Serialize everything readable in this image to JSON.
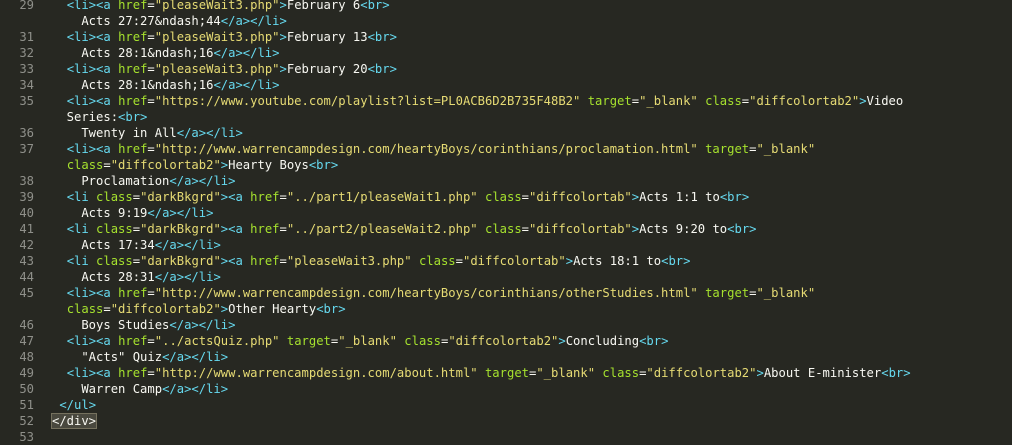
{
  "editor": {
    "colors": {
      "background": "#272822",
      "tag": "#66d9ef",
      "attribute": "#a6e22e",
      "string": "#e6db74",
      "text": "#f8f8f2",
      "gutter": "#8f908a",
      "highlight": "#49483e"
    },
    "lines": [
      {
        "num": "29",
        "tokens": [
          [
            "t",
            "  "
          ],
          [
            "g",
            "<li>"
          ],
          [
            "g",
            "<a "
          ],
          [
            "a",
            "href"
          ],
          [
            "t",
            "="
          ],
          [
            "s",
            "\"pleaseWait3.php\""
          ],
          [
            "g",
            ">"
          ],
          [
            "t",
            "February 6"
          ],
          [
            "g",
            "<br>"
          ]
        ]
      },
      {
        "num": "",
        "tokens": [
          [
            "t",
            "    Acts 27:27&ndash;44"
          ],
          [
            "g",
            "</a>"
          ],
          [
            "g",
            "</li>"
          ]
        ]
      },
      {
        "num": "31",
        "tokens": [
          [
            "t",
            "  "
          ],
          [
            "g",
            "<li>"
          ],
          [
            "g",
            "<a "
          ],
          [
            "a",
            "href"
          ],
          [
            "t",
            "="
          ],
          [
            "s",
            "\"pleaseWait3.php\""
          ],
          [
            "g",
            ">"
          ],
          [
            "t",
            "February 13"
          ],
          [
            "g",
            "<br>"
          ]
        ]
      },
      {
        "num": "32",
        "tokens": [
          [
            "t",
            "    Acts 28:1&ndash;16"
          ],
          [
            "g",
            "</a>"
          ],
          [
            "g",
            "</li>"
          ]
        ]
      },
      {
        "num": "33",
        "tokens": [
          [
            "t",
            "  "
          ],
          [
            "g",
            "<li>"
          ],
          [
            "g",
            "<a "
          ],
          [
            "a",
            "href"
          ],
          [
            "t",
            "="
          ],
          [
            "s",
            "\"pleaseWait3.php\""
          ],
          [
            "g",
            ">"
          ],
          [
            "t",
            "February 20"
          ],
          [
            "g",
            "<br>"
          ]
        ]
      },
      {
        "num": "34",
        "tokens": [
          [
            "t",
            "    Acts 28:1&ndash;16"
          ],
          [
            "g",
            "</a>"
          ],
          [
            "g",
            "</li>"
          ]
        ]
      },
      {
        "num": "35",
        "tokens": [
          [
            "t",
            "  "
          ],
          [
            "g",
            "<li>"
          ],
          [
            "g",
            "<a "
          ],
          [
            "a",
            "href"
          ],
          [
            "t",
            "="
          ],
          [
            "s",
            "\"https://www.youtube.com/playlist?list=PL0ACB6D2B735F48B2\""
          ],
          [
            "t",
            " "
          ],
          [
            "a",
            "target"
          ],
          [
            "t",
            "="
          ],
          [
            "s",
            "\"_blank\""
          ],
          [
            "t",
            " "
          ],
          [
            "a",
            "class"
          ],
          [
            "t",
            "="
          ],
          [
            "s",
            "\"diffcolortab2\""
          ],
          [
            "g",
            ">"
          ],
          [
            "t",
            "Video"
          ]
        ]
      },
      {
        "num": "",
        "tokens": [
          [
            "t",
            "  Series:"
          ],
          [
            "g",
            "<br>"
          ]
        ]
      },
      {
        "num": "36",
        "tokens": [
          [
            "t",
            "    Twenty in All"
          ],
          [
            "g",
            "</a>"
          ],
          [
            "g",
            "</li>"
          ]
        ]
      },
      {
        "num": "37",
        "tokens": [
          [
            "t",
            "  "
          ],
          [
            "g",
            "<li>"
          ],
          [
            "g",
            "<a "
          ],
          [
            "a",
            "href"
          ],
          [
            "t",
            "="
          ],
          [
            "s",
            "\"http://www.warrencampdesign.com/heartyBoys/corinthians/proclamation.html\""
          ],
          [
            "t",
            " "
          ],
          [
            "a",
            "target"
          ],
          [
            "t",
            "="
          ],
          [
            "s",
            "\"_blank\""
          ]
        ]
      },
      {
        "num": "",
        "tokens": [
          [
            "t",
            "  "
          ],
          [
            "a",
            "class"
          ],
          [
            "t",
            "="
          ],
          [
            "s",
            "\"diffcolortab2\""
          ],
          [
            "g",
            ">"
          ],
          [
            "t",
            "Hearty Boys"
          ],
          [
            "g",
            "<br>"
          ]
        ]
      },
      {
        "num": "38",
        "tokens": [
          [
            "t",
            "    Proclamation"
          ],
          [
            "g",
            "</a>"
          ],
          [
            "g",
            "</li>"
          ]
        ]
      },
      {
        "num": "39",
        "tokens": [
          [
            "t",
            "  "
          ],
          [
            "g",
            "<li "
          ],
          [
            "a",
            "class"
          ],
          [
            "t",
            "="
          ],
          [
            "s",
            "\"darkBkgrd\""
          ],
          [
            "g",
            ">"
          ],
          [
            "g",
            "<a "
          ],
          [
            "a",
            "href"
          ],
          [
            "t",
            "="
          ],
          [
            "s",
            "\"../part1/pleaseWait1.php\""
          ],
          [
            "t",
            " "
          ],
          [
            "a",
            "class"
          ],
          [
            "t",
            "="
          ],
          [
            "s",
            "\"diffcolortab\""
          ],
          [
            "g",
            ">"
          ],
          [
            "t",
            "Acts 1:1 to"
          ],
          [
            "g",
            "<br>"
          ]
        ]
      },
      {
        "num": "40",
        "tokens": [
          [
            "t",
            "    Acts 9:19"
          ],
          [
            "g",
            "</a>"
          ],
          [
            "g",
            "</li>"
          ]
        ]
      },
      {
        "num": "41",
        "tokens": [
          [
            "t",
            "  "
          ],
          [
            "g",
            "<li "
          ],
          [
            "a",
            "class"
          ],
          [
            "t",
            "="
          ],
          [
            "s",
            "\"darkBkgrd\""
          ],
          [
            "g",
            ">"
          ],
          [
            "g",
            "<a "
          ],
          [
            "a",
            "href"
          ],
          [
            "t",
            "="
          ],
          [
            "s",
            "\"../part2/pleaseWait2.php\""
          ],
          [
            "t",
            " "
          ],
          [
            "a",
            "class"
          ],
          [
            "t",
            "="
          ],
          [
            "s",
            "\"diffcolortab\""
          ],
          [
            "g",
            ">"
          ],
          [
            "t",
            "Acts 9:20 to"
          ],
          [
            "g",
            "<br>"
          ]
        ]
      },
      {
        "num": "42",
        "tokens": [
          [
            "t",
            "    Acts 17:34"
          ],
          [
            "g",
            "</a>"
          ],
          [
            "g",
            "</li>"
          ]
        ]
      },
      {
        "num": "43",
        "tokens": [
          [
            "t",
            "  "
          ],
          [
            "g",
            "<li "
          ],
          [
            "a",
            "class"
          ],
          [
            "t",
            "="
          ],
          [
            "s",
            "\"darkBkgrd\""
          ],
          [
            "g",
            ">"
          ],
          [
            "g",
            "<a "
          ],
          [
            "a",
            "href"
          ],
          [
            "t",
            "="
          ],
          [
            "s",
            "\"pleaseWait3.php\""
          ],
          [
            "t",
            " "
          ],
          [
            "a",
            "class"
          ],
          [
            "t",
            "="
          ],
          [
            "s",
            "\"diffcolortab\""
          ],
          [
            "g",
            ">"
          ],
          [
            "t",
            "Acts 18:1 to"
          ],
          [
            "g",
            "<br>"
          ]
        ]
      },
      {
        "num": "44",
        "tokens": [
          [
            "t",
            "    Acts 28:31"
          ],
          [
            "g",
            "</a>"
          ],
          [
            "g",
            "</li>"
          ]
        ]
      },
      {
        "num": "45",
        "tokens": [
          [
            "t",
            "  "
          ],
          [
            "g",
            "<li>"
          ],
          [
            "g",
            "<a "
          ],
          [
            "a",
            "href"
          ],
          [
            "t",
            "="
          ],
          [
            "s",
            "\"http://www.warrencampdesign.com/heartyBoys/corinthians/otherStudies.html\""
          ],
          [
            "t",
            " "
          ],
          [
            "a",
            "target"
          ],
          [
            "t",
            "="
          ],
          [
            "s",
            "\"_blank\""
          ]
        ]
      },
      {
        "num": "",
        "tokens": [
          [
            "t",
            "  "
          ],
          [
            "a",
            "class"
          ],
          [
            "t",
            "="
          ],
          [
            "s",
            "\"diffcolortab2\""
          ],
          [
            "g",
            ">"
          ],
          [
            "t",
            "Other Hearty"
          ],
          [
            "g",
            "<br>"
          ]
        ]
      },
      {
        "num": "46",
        "tokens": [
          [
            "t",
            "    Boys Studies"
          ],
          [
            "g",
            "</a>"
          ],
          [
            "g",
            "</li>"
          ]
        ]
      },
      {
        "num": "47",
        "tokens": [
          [
            "t",
            "  "
          ],
          [
            "g",
            "<li>"
          ],
          [
            "g",
            "<a "
          ],
          [
            "a",
            "href"
          ],
          [
            "t",
            "="
          ],
          [
            "s",
            "\"../actsQuiz.php\""
          ],
          [
            "t",
            " "
          ],
          [
            "a",
            "target"
          ],
          [
            "t",
            "="
          ],
          [
            "s",
            "\"_blank\""
          ],
          [
            "t",
            " "
          ],
          [
            "a",
            "class"
          ],
          [
            "t",
            "="
          ],
          [
            "s",
            "\"diffcolortab2\""
          ],
          [
            "g",
            ">"
          ],
          [
            "t",
            "Concluding"
          ],
          [
            "g",
            "<br>"
          ]
        ]
      },
      {
        "num": "48",
        "tokens": [
          [
            "t",
            "    \"Acts\" Quiz"
          ],
          [
            "g",
            "</a>"
          ],
          [
            "g",
            "</li>"
          ]
        ]
      },
      {
        "num": "49",
        "tokens": [
          [
            "t",
            "  "
          ],
          [
            "g",
            "<li>"
          ],
          [
            "g",
            "<a "
          ],
          [
            "a",
            "href"
          ],
          [
            "t",
            "="
          ],
          [
            "s",
            "\"http://www.warrencampdesign.com/about.html\""
          ],
          [
            "t",
            " "
          ],
          [
            "a",
            "target"
          ],
          [
            "t",
            "="
          ],
          [
            "s",
            "\"_blank\""
          ],
          [
            "t",
            " "
          ],
          [
            "a",
            "class"
          ],
          [
            "t",
            "="
          ],
          [
            "s",
            "\"diffcolortab2\""
          ],
          [
            "g",
            ">"
          ],
          [
            "t",
            "About E-minister"
          ],
          [
            "g",
            "<br>"
          ]
        ]
      },
      {
        "num": "50",
        "tokens": [
          [
            "t",
            "    Warren Camp"
          ],
          [
            "g",
            "</a>"
          ],
          [
            "g",
            "</li>"
          ]
        ]
      },
      {
        "num": "51",
        "tokens": [
          [
            "t",
            " "
          ],
          [
            "g",
            "</ul>"
          ]
        ]
      },
      {
        "num": "52",
        "tokens": [
          [
            "h",
            "</div>"
          ]
        ]
      },
      {
        "num": "53",
        "tokens": []
      }
    ]
  }
}
